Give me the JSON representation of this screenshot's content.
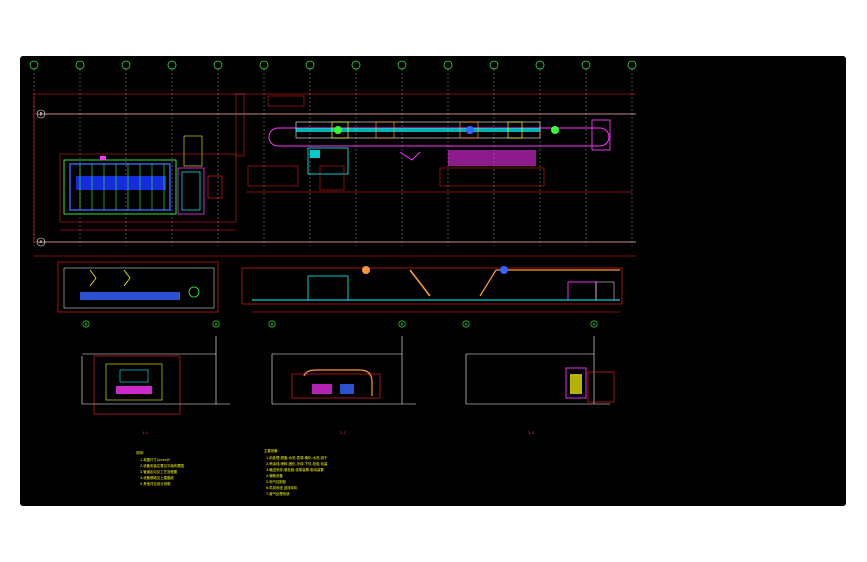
{
  "drawing": {
    "background": "#000000",
    "colors": {
      "dimension": "#ff2020",
      "outline": "#ffffff",
      "equipment": "#00ffff",
      "accent_magenta": "#ff33ff",
      "accent_green": "#33ff33",
      "accent_yellow": "#ffff00",
      "accent_blue": "#3366ff",
      "accent_orange": "#ff9933"
    },
    "grid_axis_count": 14,
    "row_markers": [
      "B",
      "A"
    ],
    "section_marks": [
      "B",
      "B",
      "B",
      "B",
      "A",
      "A"
    ],
    "view_labels": [
      "1-1",
      "2-2",
      "3-3"
    ],
    "notes_left": {
      "heading": "说明:",
      "lines": [
        "1.本图尺寸以mm计",
        "2.设备安装位置见平面布置图",
        "3.管道走向见工艺流程图",
        "4.设备基础见土建图纸",
        "5.其他详见设计说明"
      ]
    },
    "notes_right": {
      "heading": "主要设备:",
      "lines": [
        "1.前处理-脱脂-水洗-表调-磷化-水洗-烘干",
        "2.喷涂线-喷粉-固化-冷却-下件-检验-包装",
        "3.输送系统-悬挂链-张紧装置-驱动装置",
        "4.辅助设备",
        "5.电气控制柜",
        "6.供风系统 送排风机",
        "7.废气处理系统"
      ]
    }
  }
}
